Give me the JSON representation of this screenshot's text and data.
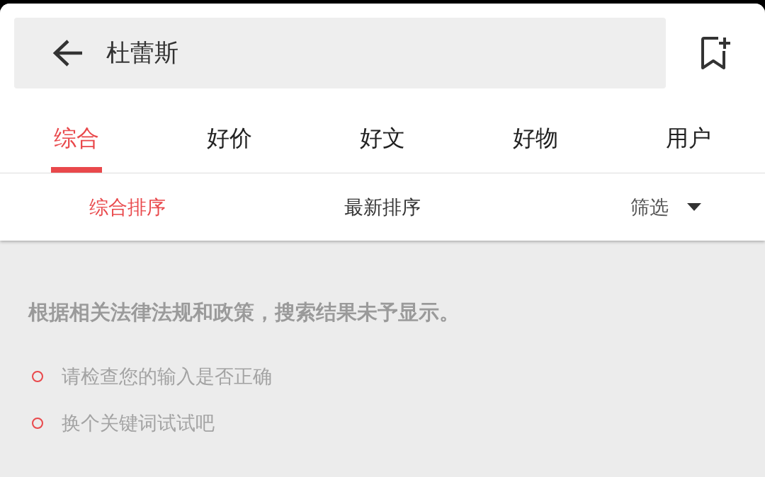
{
  "search": {
    "value": "杜蕾斯"
  },
  "tabs": [
    {
      "label": "综合",
      "selected": true
    },
    {
      "label": "好价",
      "selected": false
    },
    {
      "label": "好文",
      "selected": false
    },
    {
      "label": "好物",
      "selected": false
    },
    {
      "label": "用户",
      "selected": false
    }
  ],
  "sort_options": [
    {
      "label": "综合排序",
      "selected": true,
      "kind": "sort"
    },
    {
      "label": "最新排序",
      "selected": false,
      "kind": "sort"
    },
    {
      "label": "筛选",
      "selected": false,
      "kind": "filter"
    }
  ],
  "notice": "根据相关法律法规和政策，搜索结果未予显示。",
  "tips": [
    "请检查您的输入是否正确",
    "换个关键词试试吧"
  ]
}
